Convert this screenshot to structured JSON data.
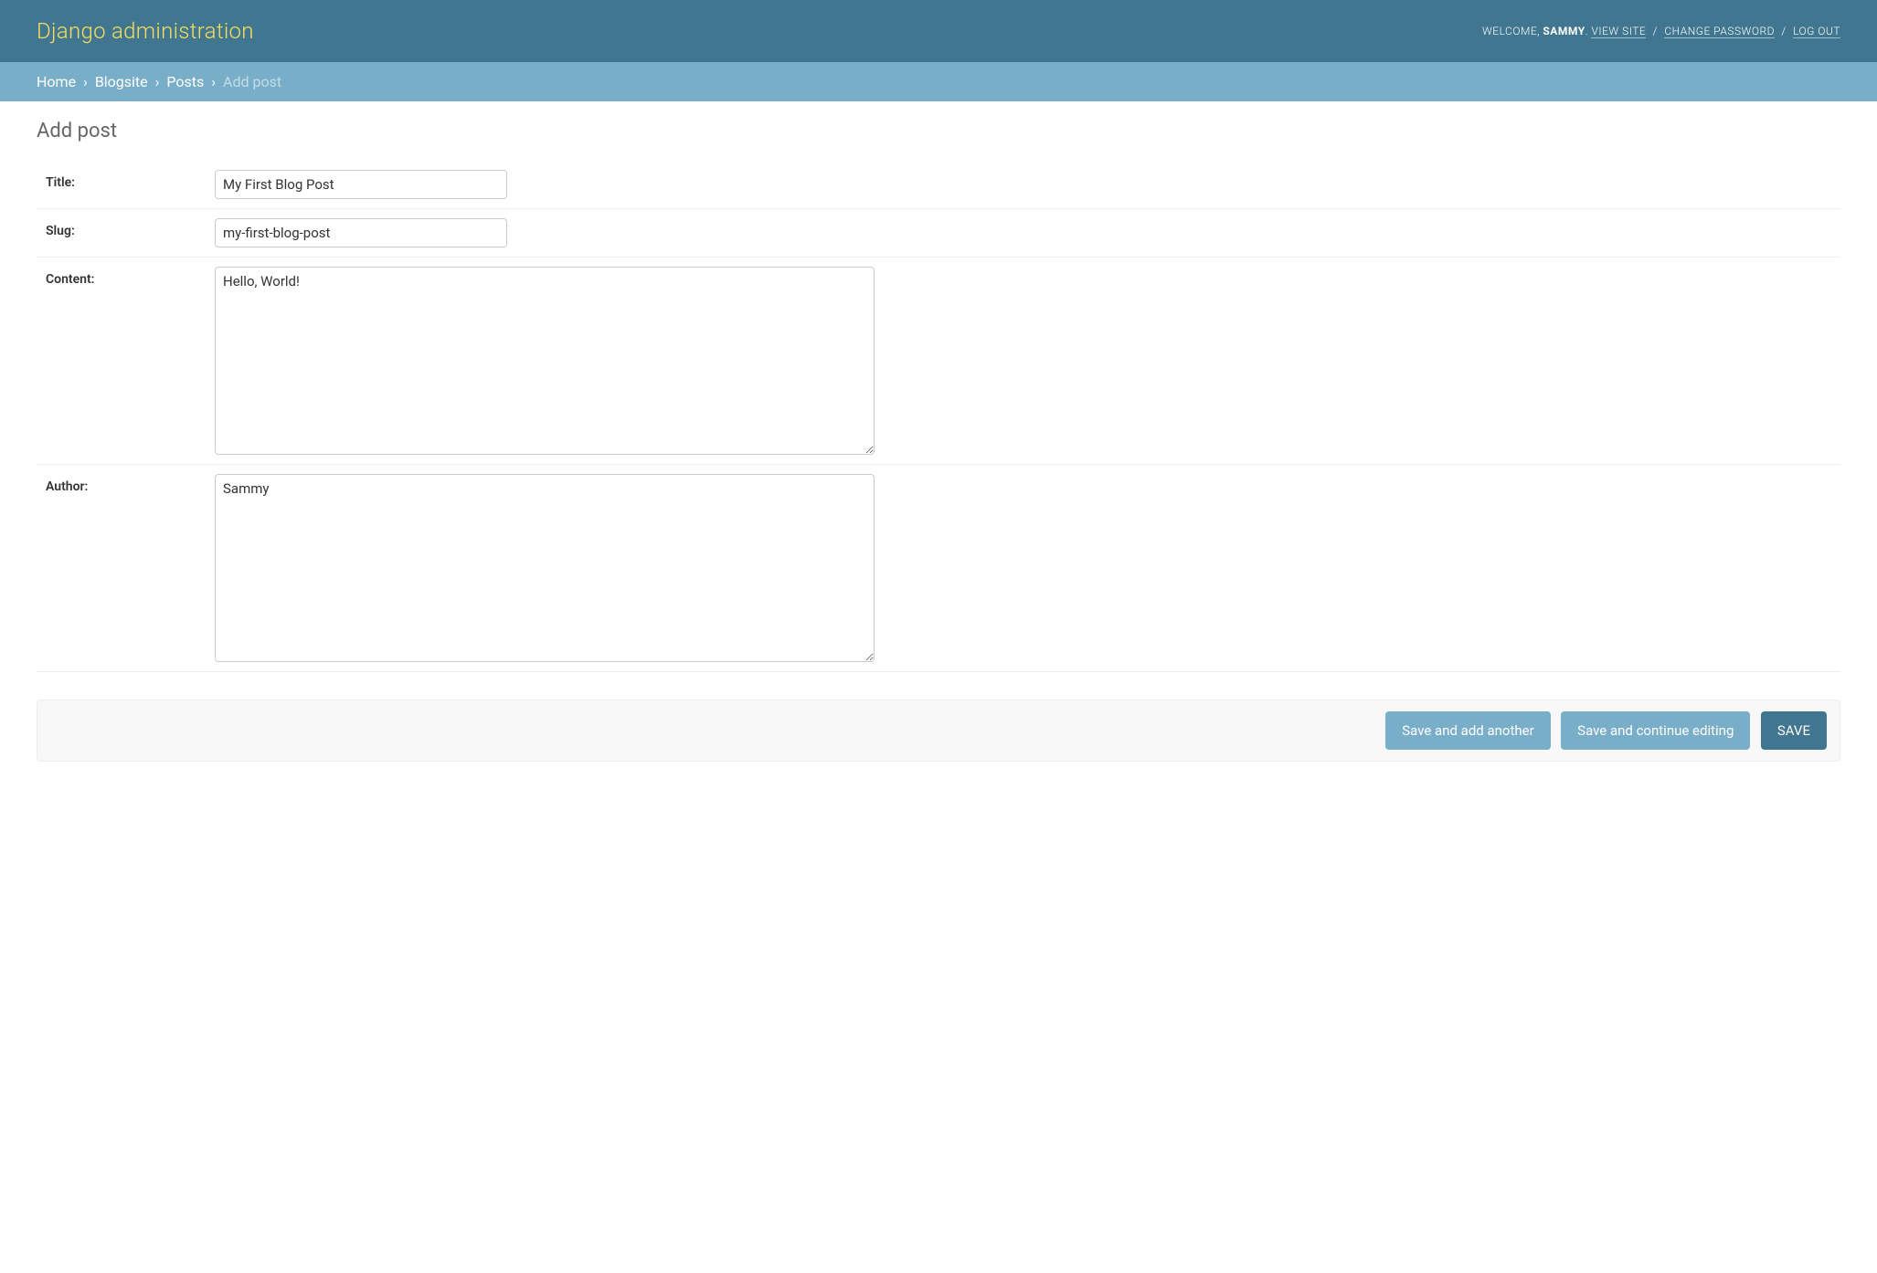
{
  "header": {
    "branding": "Django administration",
    "welcome": "WELCOME,",
    "username": "SAMMY",
    "view_site": "VIEW SITE",
    "change_password": "CHANGE PASSWORD",
    "log_out": "LOG OUT"
  },
  "breadcrumbs": {
    "home": "Home",
    "blogsite": "Blogsite",
    "posts": "Posts",
    "add_post": "Add post"
  },
  "page": {
    "title": "Add post"
  },
  "form": {
    "title_label": "Title:",
    "title_value": "My First Blog Post",
    "slug_label": "Slug:",
    "slug_value": "my-first-blog-post",
    "content_label": "Content:",
    "content_value": "Hello, World!",
    "author_label": "Author:",
    "author_value": "Sammy"
  },
  "buttons": {
    "save_add_another": "Save and add another",
    "save_continue": "Save and continue editing",
    "save": "SAVE"
  }
}
